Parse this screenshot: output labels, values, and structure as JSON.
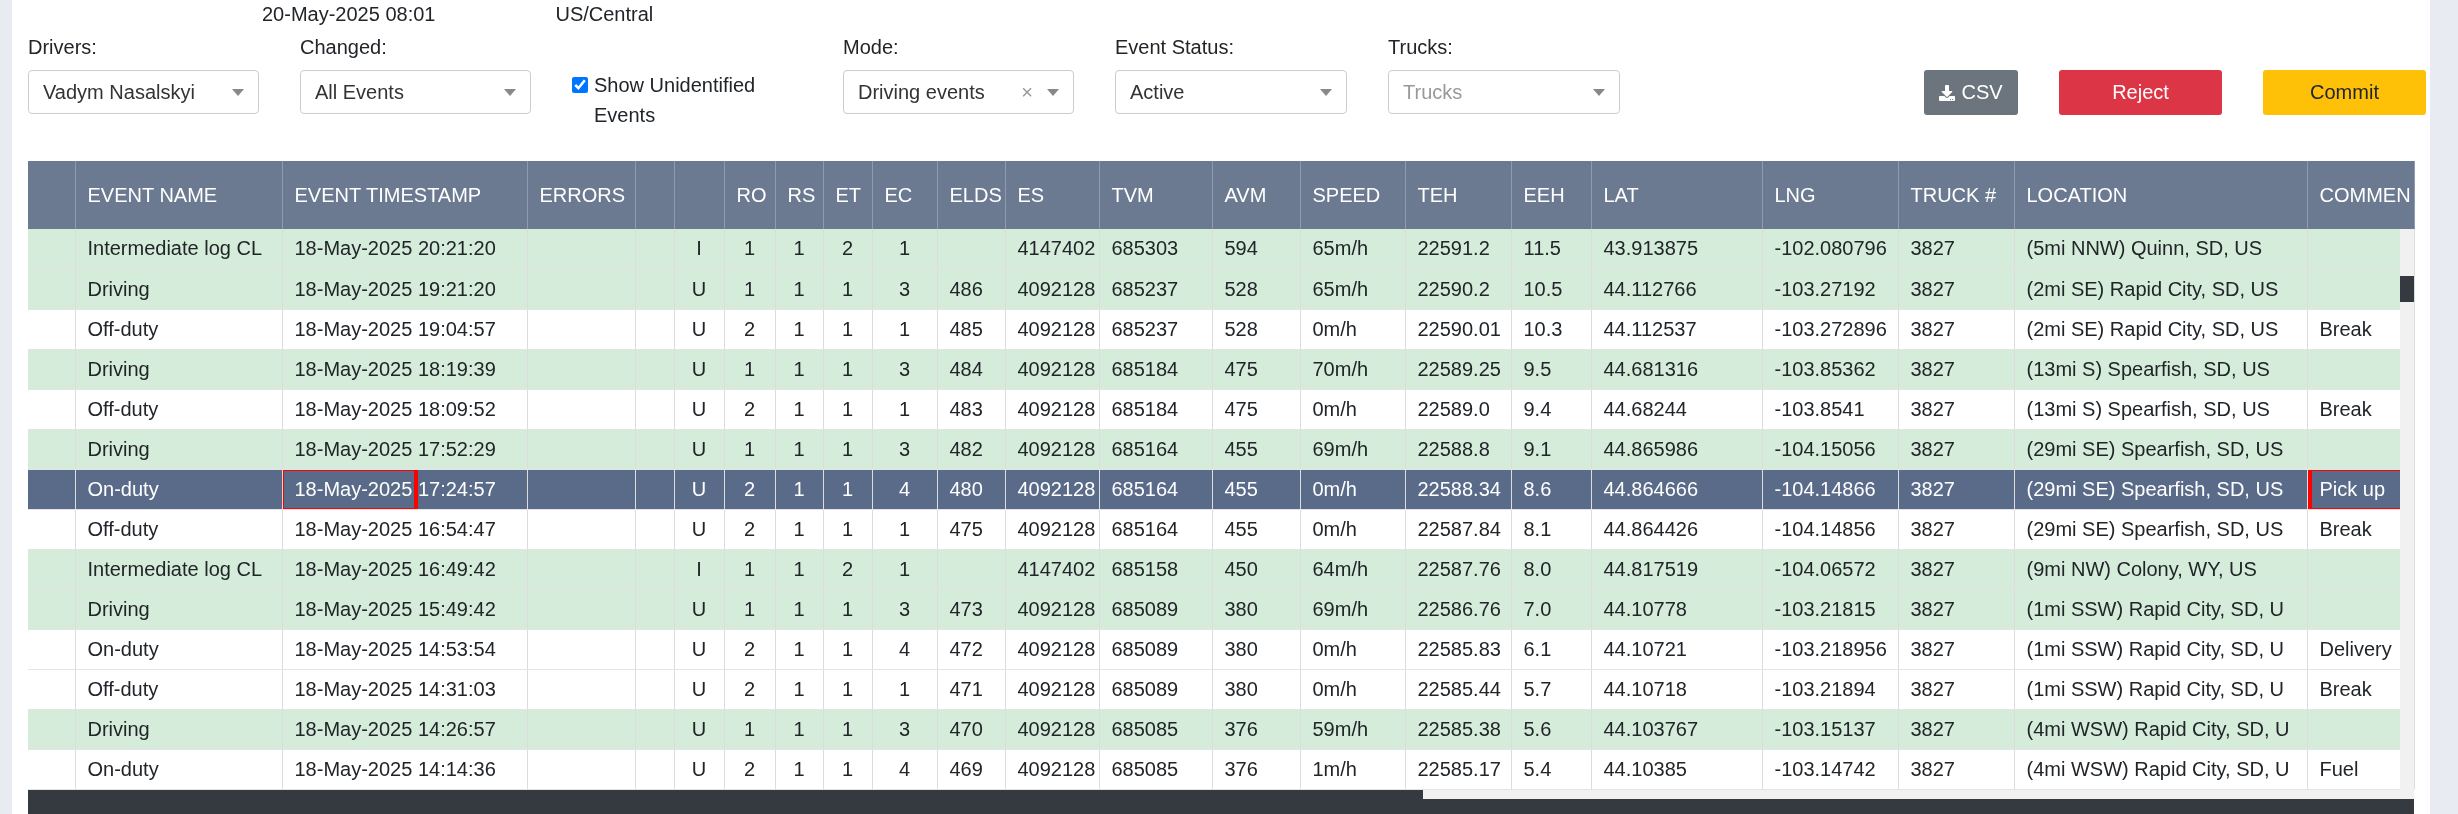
{
  "header_info": {
    "date": "20-May-2025 08:01",
    "timezone": "US/Central"
  },
  "filters": [
    {
      "kind": "select",
      "label": "Drivers:",
      "value": "Vadym Nasalskyi"
    },
    {
      "kind": "select",
      "label": "Changed:",
      "value": "All Events"
    },
    {
      "kind": "checkbox",
      "label": "Show Unidentified Events",
      "checked": true
    },
    {
      "kind": "select",
      "label": "Mode:",
      "value": "Driving events",
      "clear": "×"
    },
    {
      "kind": "select",
      "label": "Event Status:",
      "value": "Active"
    },
    {
      "kind": "select",
      "label": "Trucks:",
      "placeholder": "Trucks"
    }
  ],
  "actions": [
    {
      "kind": "csv",
      "label": "CSV"
    },
    {
      "kind": "reject",
      "label": "Reject"
    },
    {
      "kind": "commit",
      "label": "Commit"
    }
  ],
  "columns": [
    null,
    "EVENT NAME",
    "EVENT TIMESTAMP",
    "ERRORS",
    null,
    null,
    "RO",
    "RS",
    "ET",
    "EC",
    "ELDS",
    "ES",
    "TVM",
    "AVM",
    "SPEED",
    "TEH",
    "EEH",
    "LAT",
    "LNG",
    "TRUCK #",
    "LOCATION",
    "COMMEN"
  ],
  "rows": [
    {
      "shaded": true,
      "selected": false,
      "cells": [
        null,
        "Intermediate log CL",
        "18-May-2025 20:21:20",
        null,
        null,
        "I",
        "1",
        "1",
        "2",
        "1",
        null,
        "4147402",
        "685303",
        "594",
        "65m/h",
        "22591.2",
        "11.5",
        "43.913875",
        "-102.080796",
        "3827",
        "(5mi NNW) Quinn, SD, US",
        null
      ]
    },
    {
      "shaded": true,
      "selected": false,
      "cells": [
        null,
        "Driving",
        "18-May-2025 19:21:20",
        null,
        null,
        "U",
        "1",
        "1",
        "1",
        "3",
        "486",
        "4092128",
        "685237",
        "528",
        "65m/h",
        "22590.2",
        "10.5",
        "44.112766",
        "-103.27192",
        "3827",
        "(2mi SE) Rapid City, SD, US",
        null
      ]
    },
    {
      "shaded": false,
      "selected": false,
      "cells": [
        null,
        "Off-duty",
        "18-May-2025 19:04:57",
        null,
        null,
        "U",
        "2",
        "1",
        "1",
        "1",
        "485",
        "4092128",
        "685237",
        "528",
        "0m/h",
        "22590.01",
        "10.3",
        "44.112537",
        "-103.272896",
        "3827",
        "(2mi SE) Rapid City, SD, US",
        "Break"
      ]
    },
    {
      "shaded": true,
      "selected": false,
      "cells": [
        null,
        "Driving",
        "18-May-2025 18:19:39",
        null,
        null,
        "U",
        "1",
        "1",
        "1",
        "3",
        "484",
        "4092128",
        "685184",
        "475",
        "70m/h",
        "22589.25",
        "9.5",
        "44.681316",
        "-103.85362",
        "3827",
        "(13mi S) Spearfish, SD, US",
        null
      ]
    },
    {
      "shaded": false,
      "selected": false,
      "cells": [
        null,
        "Off-duty",
        "18-May-2025 18:09:52",
        null,
        null,
        "U",
        "2",
        "1",
        "1",
        "1",
        "483",
        "4092128",
        "685184",
        "475",
        "0m/h",
        "22589.0",
        "9.4",
        "44.68244",
        "-103.8541",
        "3827",
        "(13mi S) Spearfish, SD, US",
        "Break"
      ]
    },
    {
      "shaded": true,
      "selected": false,
      "cells": [
        null,
        "Driving",
        "18-May-2025 17:52:29",
        null,
        null,
        "U",
        "1",
        "1",
        "1",
        "3",
        "482",
        "4092128",
        "685164",
        "455",
        "69m/h",
        "22588.8",
        "9.1",
        "44.865986",
        "-104.15056",
        "3827",
        "(29mi SE) Spearfish, SD, US",
        null
      ]
    },
    {
      "shaded": false,
      "selected": true,
      "cells": [
        null,
        "On-duty",
        {
          "text": "18-May-2025 17:24:57",
          "marked": true
        },
        null,
        null,
        "U",
        "2",
        "1",
        "1",
        "4",
        "480",
        "4092128",
        "685164",
        "455",
        "0m/h",
        "22588.34",
        "8.6",
        "44.864666",
        "-104.14866",
        "3827",
        "(29mi SE) Spearfish, SD, US",
        {
          "text": "Pick up",
          "marked": true
        }
      ]
    },
    {
      "shaded": false,
      "selected": false,
      "cells": [
        null,
        "Off-duty",
        "18-May-2025 16:54:47",
        null,
        null,
        "U",
        "2",
        "1",
        "1",
        "1",
        "475",
        "4092128",
        "685164",
        "455",
        "0m/h",
        "22587.84",
        "8.1",
        "44.864426",
        "-104.14856",
        "3827",
        "(29mi SE) Spearfish, SD, US",
        "Break"
      ]
    },
    {
      "shaded": true,
      "selected": false,
      "cells": [
        null,
        "Intermediate log CL",
        "18-May-2025 16:49:42",
        null,
        null,
        "I",
        "1",
        "1",
        "2",
        "1",
        null,
        "4147402",
        "685158",
        "450",
        "64m/h",
        "22587.76",
        "8.0",
        "44.817519",
        "-104.06572",
        "3827",
        "(9mi NW) Colony, WY, US",
        null
      ]
    },
    {
      "shaded": true,
      "selected": false,
      "cells": [
        null,
        "Driving",
        "18-May-2025 15:49:42",
        null,
        null,
        "U",
        "1",
        "1",
        "1",
        "3",
        "473",
        "4092128",
        "685089",
        "380",
        "69m/h",
        "22586.76",
        "7.0",
        "44.10778",
        "-103.21815",
        "3827",
        "(1mi SSW) Rapid City, SD, U",
        null
      ]
    },
    {
      "shaded": false,
      "selected": false,
      "cells": [
        null,
        "On-duty",
        "18-May-2025 14:53:54",
        null,
        null,
        "U",
        "2",
        "1",
        "1",
        "4",
        "472",
        "4092128",
        "685089",
        "380",
        "0m/h",
        "22585.83",
        "6.1",
        "44.10721",
        "-103.218956",
        "3827",
        "(1mi SSW) Rapid City, SD, U",
        "Delivery"
      ]
    },
    {
      "shaded": false,
      "selected": false,
      "cells": [
        null,
        "Off-duty",
        "18-May-2025 14:31:03",
        null,
        null,
        "U",
        "2",
        "1",
        "1",
        "1",
        "471",
        "4092128",
        "685089",
        "380",
        "0m/h",
        "22585.44",
        "5.7",
        "44.10718",
        "-103.21894",
        "3827",
        "(1mi SSW) Rapid City, SD, U",
        "Break"
      ]
    },
    {
      "shaded": true,
      "selected": false,
      "cells": [
        null,
        "Driving",
        "18-May-2025 14:26:57",
        null,
        null,
        "U",
        "1",
        "1",
        "1",
        "3",
        "470",
        "4092128",
        "685085",
        "376",
        "59m/h",
        "22585.38",
        "5.6",
        "44.103767",
        "-103.15137",
        "3827",
        "(4mi WSW) Rapid City, SD, U",
        null
      ]
    },
    {
      "shaded": false,
      "selected": false,
      "cells": [
        null,
        "On-duty",
        "18-May-2025 14:14:36",
        null,
        null,
        "U",
        "2",
        "1",
        "1",
        "4",
        "469",
        "4092128",
        "685085",
        "376",
        "1m/h",
        "22585.17",
        "5.4",
        "44.10385",
        "-103.14742",
        "3827",
        "(4mi WSW) Rapid City, SD, U",
        "Fuel"
      ]
    }
  ]
}
